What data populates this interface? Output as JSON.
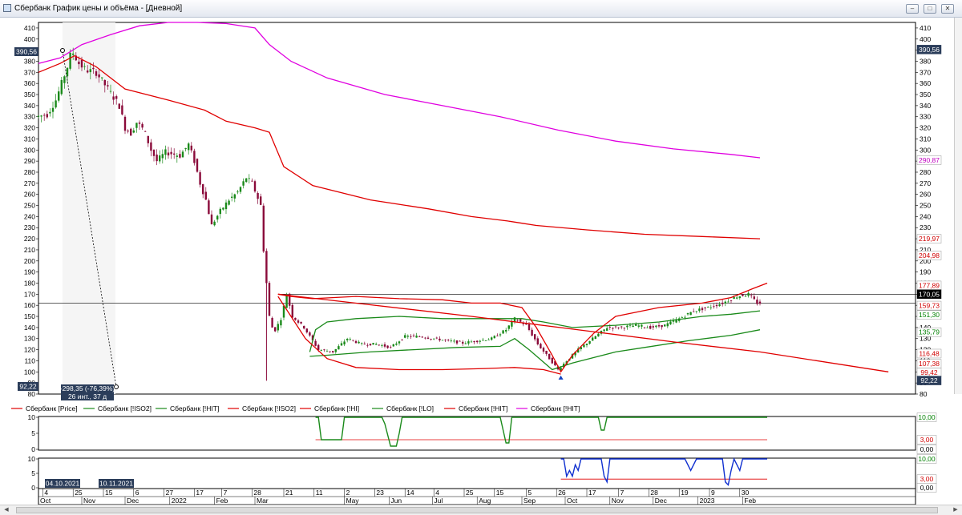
{
  "window": {
    "title": "Сбербанк График цены и объёма - [Дневной]",
    "buttons": [
      "–",
      "□",
      "✕"
    ]
  },
  "legend": [
    {
      "label": "Сбербанк [Price]",
      "color": "#e00000"
    },
    {
      "label": "Сбербанк [!ISO2]",
      "color": "#1a8a1a"
    },
    {
      "label": "Сбербанк [!HIT]",
      "color": "#1a8a1a"
    },
    {
      "label": "Сбербанк [!ISO2]",
      "color": "#e00000"
    },
    {
      "label": "Сбербанк [!HI]",
      "color": "#e00000"
    },
    {
      "label": "Сбербанк [!LO]",
      "color": "#1a8a1a"
    },
    {
      "label": "Сбербанк [!HIT]",
      "color": "#e00000"
    },
    {
      "label": "Сбербанк [!HIT]",
      "color": "#e000e0"
    }
  ],
  "annotations": {
    "measure_line1": "-298,35 (-76,39%)",
    "measure_line2": "26 инт., 37 д",
    "date_left": "04.10.2021",
    "date_right": "10.11.2021"
  },
  "price_tags": {
    "left_high": "390,56",
    "left_low": "92,22",
    "right": [
      {
        "text": "390,56",
        "value": 390.56,
        "bg": "#2b3d5a",
        "fg": "#ffffff"
      },
      {
        "text": "290,87",
        "value": 290.87,
        "bg": "#ffffff",
        "fg": "#c000c0"
      },
      {
        "text": "219,97",
        "value": 219.97,
        "bg": "#ffffff",
        "fg": "#d00000"
      },
      {
        "text": "204,98",
        "value": 204.98,
        "bg": "#ffffff",
        "fg": "#d00000"
      },
      {
        "text": "177,89",
        "value": 177.89,
        "bg": "#ffffff",
        "fg": "#d00000"
      },
      {
        "text": "170,05",
        "value": 170.05,
        "bg": "#000000",
        "fg": "#ffffff"
      },
      {
        "text": "159,73",
        "value": 159.73,
        "bg": "#ffffff",
        "fg": "#d00000"
      },
      {
        "text": "151,30",
        "value": 151.3,
        "bg": "#ffffff",
        "fg": "#008000"
      },
      {
        "text": "135,79",
        "value": 135.79,
        "bg": "#ffffff",
        "fg": "#008000"
      },
      {
        "text": "116,48",
        "value": 116.48,
        "bg": "#ffffff",
        "fg": "#d00000"
      },
      {
        "text": "107,38",
        "value": 107.38,
        "bg": "#ffffff",
        "fg": "#d00000"
      },
      {
        "text": "99,42",
        "value": 99.42,
        "bg": "#ffffff",
        "fg": "#d00000"
      },
      {
        "text": "92,22",
        "value": 92.22,
        "bg": "#2b3d5a",
        "fg": "#ffffff"
      }
    ]
  },
  "sub1_tags": [
    {
      "text": "10,00",
      "value": 10,
      "fg": "#008000"
    },
    {
      "text": "3,00",
      "value": 3,
      "fg": "#d00000"
    },
    {
      "text": "0,00",
      "value": 0,
      "fg": "#000000"
    }
  ],
  "sub2_tags": [
    {
      "text": "10,00",
      "value": 10,
      "fg": "#008000"
    },
    {
      "text": "3,00",
      "value": 3,
      "fg": "#d00000"
    },
    {
      "text": "0,00",
      "value": 0,
      "fg": "#000000"
    }
  ],
  "chart_data": {
    "type": "candlestick",
    "ylim": [
      80,
      415
    ],
    "y_ticks": [
      80,
      90,
      100,
      110,
      120,
      130,
      140,
      150,
      160,
      170,
      180,
      190,
      200,
      210,
      220,
      230,
      240,
      250,
      260,
      270,
      280,
      290,
      300,
      310,
      320,
      330,
      340,
      350,
      360,
      370,
      380,
      390,
      400,
      410
    ],
    "x_day_labels": [
      "4",
      "25",
      "15",
      "6",
      "27",
      "17",
      "7",
      "28",
      "21",
      "11",
      "2",
      "23",
      "14",
      "4",
      "25",
      "15",
      "5",
      "26",
      "17",
      "7",
      "28",
      "19",
      "9",
      "30"
    ],
    "x_month_labels": [
      "Oct",
      "Nov",
      "Dec",
      "2022",
      "Feb",
      "Mar",
      "May",
      "Jun",
      "Jul",
      "Aug",
      "Sep",
      "Oct",
      "Nov",
      "Dec",
      "2023",
      "Feb"
    ],
    "x_month_first_day": [
      0,
      30,
      60,
      91,
      122,
      150,
      212,
      243,
      273,
      304,
      335,
      365,
      396,
      426,
      457,
      488
    ],
    "x_day_offsets": [
      3,
      24,
      45,
      66,
      87,
      108,
      127,
      148,
      170,
      191,
      212,
      233,
      254,
      274,
      295,
      316,
      338,
      359,
      380,
      402,
      423,
      444,
      465,
      486
    ],
    "price_path": [
      [
        0,
        330
      ],
      [
        8,
        332
      ],
      [
        14,
        345
      ],
      [
        18,
        360
      ],
      [
        22,
        375
      ],
      [
        25,
        390
      ],
      [
        30,
        378
      ],
      [
        35,
        372
      ],
      [
        42,
        370
      ],
      [
        50,
        355
      ],
      [
        58,
        340
      ],
      [
        62,
        320
      ],
      [
        66,
        315
      ],
      [
        70,
        325
      ],
      [
        75,
        318
      ],
      [
        80,
        300
      ],
      [
        84,
        290
      ],
      [
        90,
        298
      ],
      [
        100,
        295
      ],
      [
        106,
        305
      ],
      [
        110,
        290
      ],
      [
        114,
        270
      ],
      [
        118,
        255
      ],
      [
        122,
        232
      ],
      [
        128,
        245
      ],
      [
        134,
        255
      ],
      [
        140,
        262
      ],
      [
        146,
        275
      ],
      [
        150,
        270
      ],
      [
        156,
        250
      ],
      [
        158,
        210
      ],
      [
        160,
        180
      ],
      [
        162,
        150
      ],
      [
        165,
        135
      ],
      [
        170,
        148
      ],
      [
        174,
        170
      ],
      [
        178,
        150
      ],
      [
        186,
        140
      ],
      [
        196,
        120
      ],
      [
        206,
        118
      ],
      [
        216,
        130
      ],
      [
        226,
        125
      ],
      [
        236,
        125
      ],
      [
        246,
        122
      ],
      [
        256,
        132
      ],
      [
        266,
        132
      ],
      [
        276,
        130
      ],
      [
        286,
        128
      ],
      [
        296,
        126
      ],
      [
        306,
        128
      ],
      [
        316,
        130
      ],
      [
        326,
        138
      ],
      [
        332,
        148
      ],
      [
        340,
        142
      ],
      [
        348,
        125
      ],
      [
        356,
        112
      ],
      [
        362,
        102
      ],
      [
        368,
        110
      ],
      [
        376,
        120
      ],
      [
        386,
        130
      ],
      [
        396,
        140
      ],
      [
        406,
        140
      ],
      [
        416,
        142
      ],
      [
        426,
        140
      ],
      [
        436,
        142
      ],
      [
        446,
        148
      ],
      [
        456,
        155
      ],
      [
        466,
        158
      ],
      [
        476,
        162
      ],
      [
        486,
        168
      ],
      [
        494,
        170
      ],
      [
        500,
        162
      ]
    ],
    "series": [
      {
        "name": "Сбербанк [!HIT]",
        "color": "#e000e0",
        "points": [
          [
            0,
            378
          ],
          [
            15,
            383
          ],
          [
            30,
            395
          ],
          [
            50,
            404
          ],
          [
            70,
            412
          ],
          [
            90,
            415
          ],
          [
            110,
            415
          ],
          [
            130,
            414
          ],
          [
            150,
            410
          ],
          [
            160,
            395
          ],
          [
            175,
            380
          ],
          [
            200,
            365
          ],
          [
            240,
            350
          ],
          [
            280,
            340
          ],
          [
            320,
            330
          ],
          [
            360,
            318
          ],
          [
            400,
            308
          ],
          [
            440,
            301
          ],
          [
            480,
            296
          ],
          [
            500,
            293
          ]
        ]
      },
      {
        "name": "Сбербанк [!HIT]",
        "color": "#e00000",
        "points": [
          [
            0,
            370
          ],
          [
            15,
            378
          ],
          [
            25,
            385
          ],
          [
            40,
            375
          ],
          [
            60,
            355
          ],
          [
            90,
            345
          ],
          [
            115,
            336
          ],
          [
            130,
            326
          ],
          [
            150,
            320
          ],
          [
            160,
            316
          ],
          [
            170,
            285
          ],
          [
            190,
            268
          ],
          [
            230,
            255
          ],
          [
            270,
            247
          ],
          [
            300,
            240
          ],
          [
            325,
            236
          ],
          [
            335,
            234
          ],
          [
            345,
            232
          ],
          [
            380,
            228
          ],
          [
            420,
            224
          ],
          [
            460,
            222
          ],
          [
            500,
            220
          ]
        ]
      },
      {
        "name": "Сбербанк [!ISO2]",
        "color": "#1a8a1a",
        "points": [
          [
            188,
            118
          ],
          [
            192,
            138
          ],
          [
            200,
            145
          ],
          [
            220,
            148
          ],
          [
            250,
            150
          ],
          [
            280,
            148
          ],
          [
            300,
            148
          ],
          [
            315,
            148
          ],
          [
            325,
            148
          ],
          [
            335,
            148
          ],
          [
            350,
            145
          ],
          [
            370,
            140
          ],
          [
            400,
            142
          ],
          [
            430,
            145
          ],
          [
            460,
            150
          ],
          [
            480,
            152
          ],
          [
            500,
            155
          ]
        ]
      },
      {
        "name": "Сбербанк [!ISO2]",
        "color": "#1a8a1a",
        "points": [
          [
            188,
            114
          ],
          [
            200,
            115
          ],
          [
            230,
            118
          ],
          [
            260,
            120
          ],
          [
            290,
            122
          ],
          [
            320,
            123
          ],
          [
            330,
            130
          ],
          [
            340,
            120
          ],
          [
            356,
            102
          ],
          [
            370,
            108
          ],
          [
            400,
            118
          ],
          [
            420,
            122
          ],
          [
            450,
            128
          ],
          [
            480,
            133
          ],
          [
            500,
            138
          ]
        ]
      },
      {
        "name": "Сбербанк [!HI]",
        "color": "#e00000",
        "points": [
          [
            166,
            170
          ],
          [
            175,
            168
          ],
          [
            190,
            166
          ],
          [
            220,
            168
          ],
          [
            250,
            166
          ],
          [
            280,
            165
          ],
          [
            300,
            162
          ],
          [
            320,
            162
          ],
          [
            335,
            158
          ],
          [
            345,
            140
          ],
          [
            356,
            115
          ],
          [
            362,
            100
          ],
          [
            370,
            115
          ],
          [
            385,
            135
          ],
          [
            400,
            150
          ],
          [
            430,
            158
          ],
          [
            460,
            162
          ],
          [
            480,
            167
          ],
          [
            495,
            175
          ],
          [
            505,
            180
          ]
        ]
      },
      {
        "name": "Сбербанк [!LO]",
        "color": "#e00000",
        "points": [
          [
            166,
            168
          ],
          [
            175,
            150
          ],
          [
            185,
            130
          ],
          [
            200,
            112
          ],
          [
            220,
            104
          ],
          [
            250,
            102
          ],
          [
            280,
            102
          ],
          [
            310,
            103
          ],
          [
            330,
            104
          ],
          [
            350,
            102
          ],
          [
            362,
            98
          ]
        ]
      },
      {
        "name": "Сбербанк [Price]",
        "color": "#e00000",
        "points": [
          [
            166,
            170
          ],
          [
            300,
            150
          ],
          [
            380,
            137
          ],
          [
            440,
            127
          ],
          [
            500,
            118
          ],
          [
            589,
            100
          ]
        ]
      }
    ]
  }
}
